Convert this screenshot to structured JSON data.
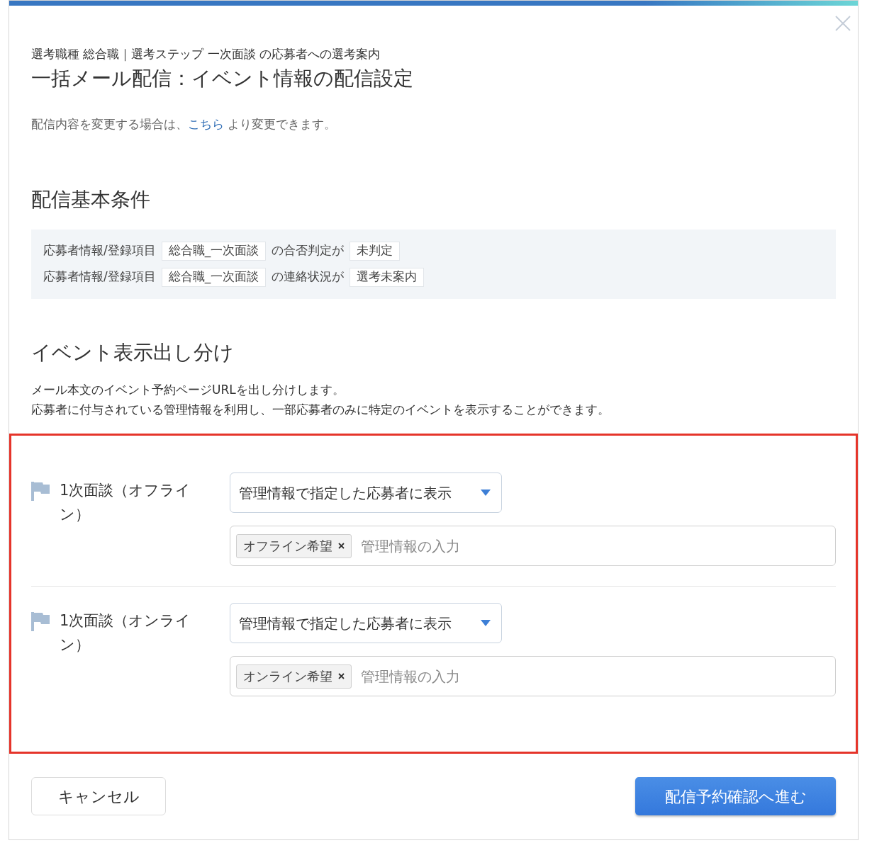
{
  "dialog": {
    "subtitle": "選考職種 総合職｜選考ステップ 一次面談 の応募者への選考案内",
    "title": "一括メール配信：イベント情報の配信設定"
  },
  "note": {
    "text_before": "配信内容を変更する場合は、",
    "link": "こちら",
    "text_after": " より変更できます。"
  },
  "basic_conditions": {
    "heading": "配信基本条件",
    "rows": [
      {
        "source": "応募者情報/登録項目",
        "item": "総合職_一次面談",
        "relation": "の合否判定が",
        "value": "未判定"
      },
      {
        "source": "応募者情報/登録項目",
        "item": "総合職_一次面談",
        "relation": "の連絡状況が",
        "value": "選考未案内"
      }
    ]
  },
  "event_display": {
    "heading": "イベント表示出し分け",
    "description": [
      "メール本文のイベント予約ページURLを出し分けします。",
      "応募者に付与されている管理情報を利用し、一部応募者のみに特定のイベントを表示することができます。"
    ],
    "events": [
      {
        "name": "1次面談（オフライン）",
        "display": "管理情報で指定した応募者に表示",
        "tags": [
          "オフライン希望"
        ],
        "placeholder": "管理情報の入力"
      },
      {
        "name": "1次面談（オンライン）",
        "display": "管理情報で指定した応募者に表示",
        "tags": [
          "オンライン希望"
        ],
        "placeholder": "管理情報の入力"
      }
    ]
  },
  "buttons": [
    {
      "label": "キャンセル",
      "kind": "secondary"
    },
    {
      "label": "配信予約確認へ進む",
      "kind": "primary"
    }
  ]
}
